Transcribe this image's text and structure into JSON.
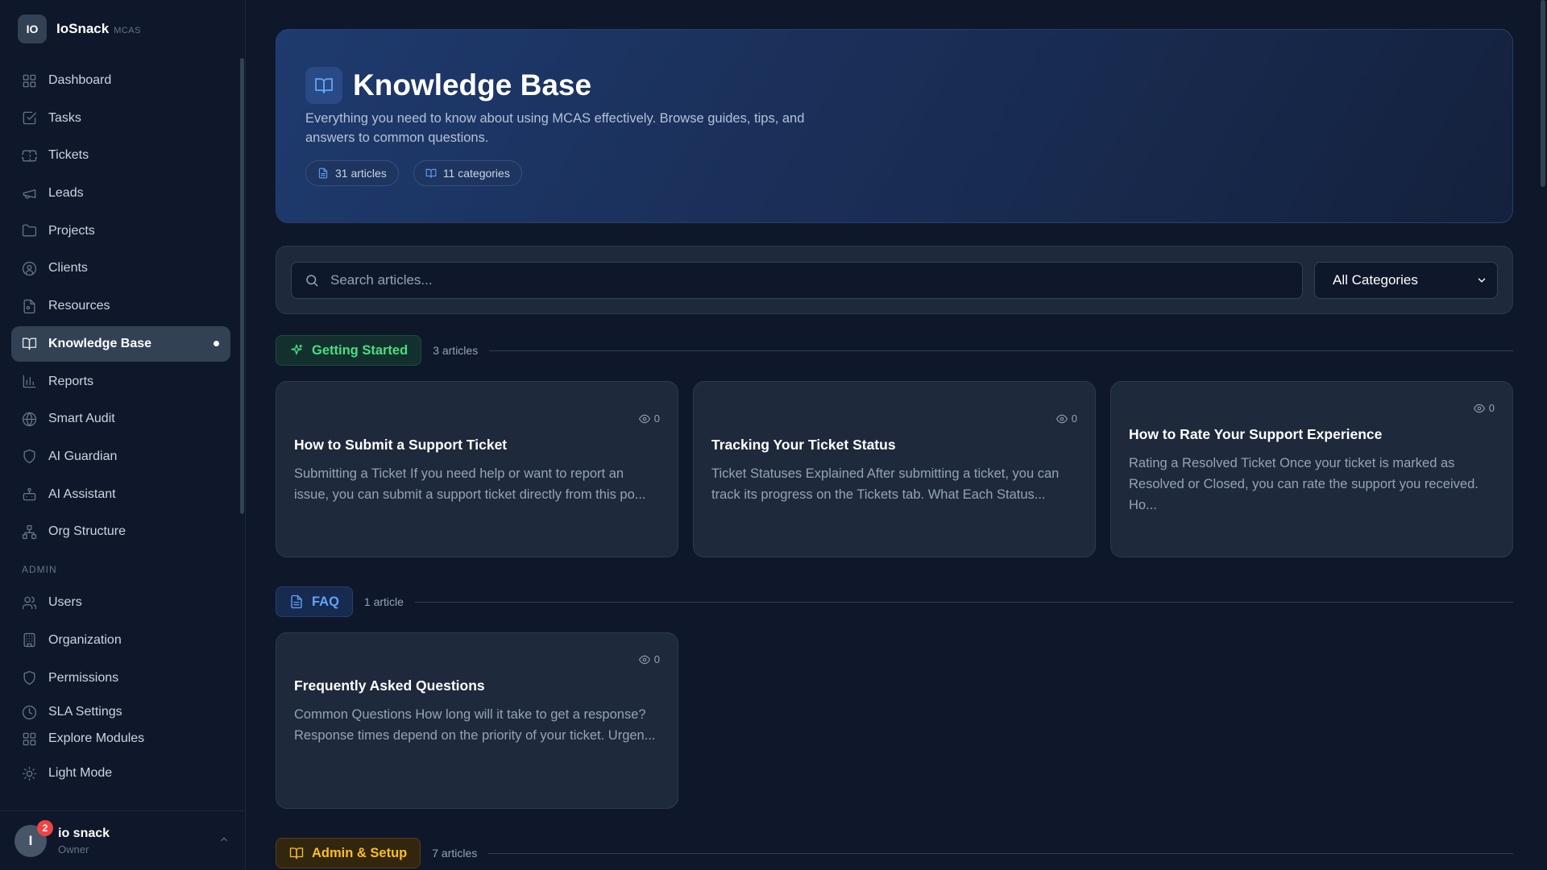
{
  "brand": {
    "logo": "IO",
    "name": "IoSnack",
    "sub": "MCAS"
  },
  "nav": [
    {
      "label": "Dashboard",
      "icon": "grid-icon"
    },
    {
      "label": "Tasks",
      "icon": "checkbox-icon"
    },
    {
      "label": "Tickets",
      "icon": "ticket-icon"
    },
    {
      "label": "Leads",
      "icon": "megaphone-icon"
    },
    {
      "label": "Projects",
      "icon": "folder-icon"
    },
    {
      "label": "Clients",
      "icon": "user-circle-icon"
    },
    {
      "label": "Resources",
      "icon": "file-icon"
    },
    {
      "label": "Knowledge Base",
      "icon": "book-icon",
      "active": true
    },
    {
      "label": "Reports",
      "icon": "bar-chart-icon"
    },
    {
      "label": "Smart Audit",
      "icon": "globe-icon"
    },
    {
      "label": "AI Guardian",
      "icon": "shield-icon"
    },
    {
      "label": "AI Assistant",
      "icon": "bot-icon"
    },
    {
      "label": "Org Structure",
      "icon": "network-icon"
    }
  ],
  "admin_label": "ADMIN",
  "admin_nav": [
    {
      "label": "Users",
      "icon": "users-icon"
    },
    {
      "label": "Organization",
      "icon": "building-icon"
    },
    {
      "label": "Permissions",
      "icon": "shield-icon"
    },
    {
      "label": "SLA Settings",
      "icon": "clock-icon"
    }
  ],
  "footer_nav": [
    {
      "label": "Explore Modules",
      "icon": "grid-icon"
    },
    {
      "label": "Light Mode",
      "icon": "sun-icon"
    }
  ],
  "user": {
    "initial": "I",
    "name": "io snack",
    "role": "Owner",
    "badge": "2"
  },
  "hero": {
    "title": "Knowledge Base",
    "description": "Everything you need to know about using MCAS effectively. Browse guides, tips, and answers to common questions.",
    "articles_chip": "31 articles",
    "categories_chip": "11 categories"
  },
  "search": {
    "placeholder": "Search articles...",
    "category_select": "All Categories"
  },
  "categories": [
    {
      "name": "Getting Started",
      "count": "3 articles",
      "icon": "sparkle-icon",
      "articles": [
        {
          "views": "0",
          "title": "How to Submit a Support Ticket",
          "excerpt": "Submitting a Ticket If you need help or want to report an issue, you can submit a support ticket directly from this po..."
        },
        {
          "views": "0",
          "title": "Tracking Your Ticket Status",
          "excerpt": "Ticket Statuses Explained After submitting a ticket, you can track its progress on the Tickets tab. What Each Status..."
        },
        {
          "views": "0",
          "title": "How to Rate Your Support Experience",
          "excerpt": "Rating a Resolved Ticket Once your ticket is marked as Resolved or Closed, you can rate the support you received. Ho..."
        }
      ]
    },
    {
      "name": "FAQ",
      "count": "1 article",
      "icon": "document-icon",
      "articles": [
        {
          "views": "0",
          "title": "Frequently Asked Questions",
          "excerpt": "Common Questions How long will it take to get a response? Response times depend on the priority of your ticket. Urgen..."
        }
      ]
    },
    {
      "name": "Admin & Setup",
      "count": "7 articles",
      "icon": "book-icon"
    }
  ]
}
